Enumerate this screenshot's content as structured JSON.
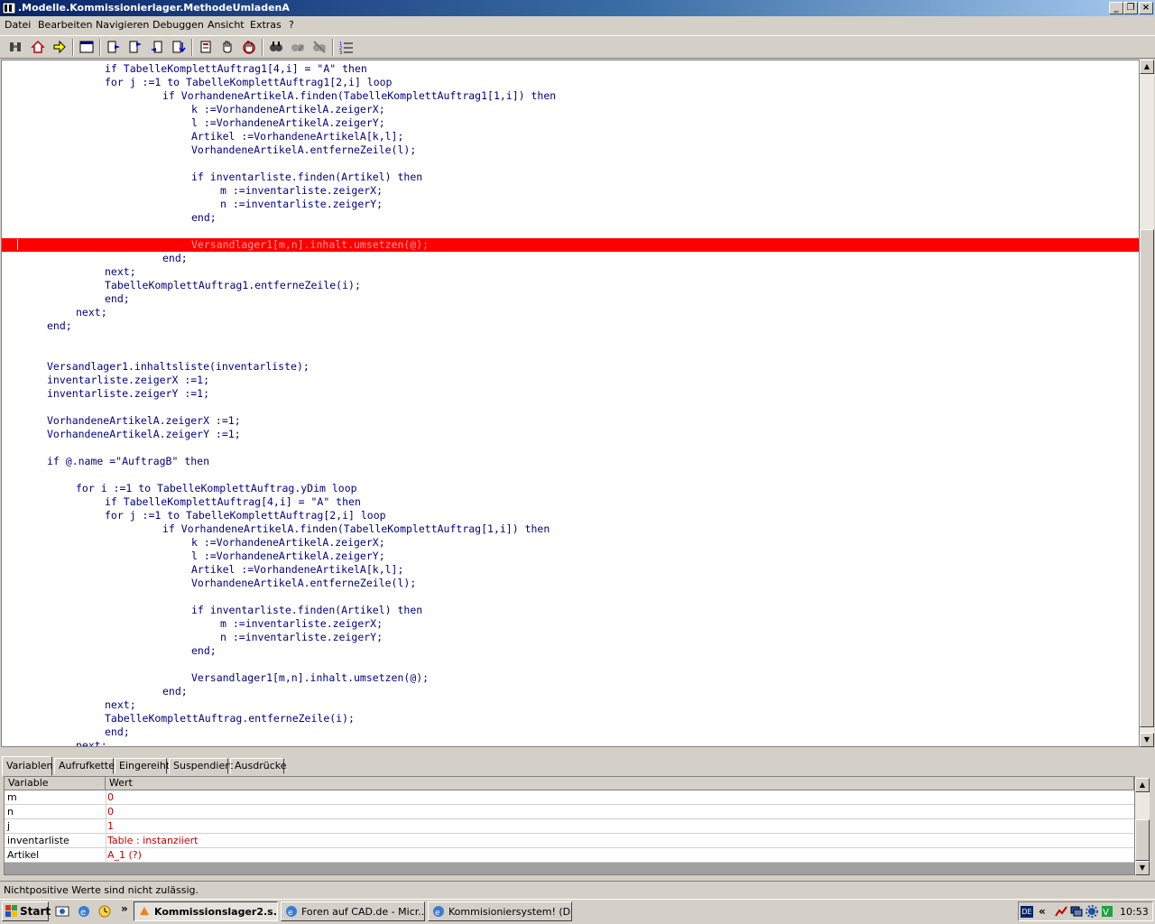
{
  "window": {
    "title": ".Modelle.Kommissionierlager.MethodeUmladenA"
  },
  "menu": [
    "Datei",
    "Bearbeiten",
    "Navigieren",
    "Debuggen",
    "Ansicht",
    "Extras",
    "?"
  ],
  "toolbar_icons": [
    "binoculars-icon",
    "home-icon",
    "arrow-right-icon",
    "window-icon",
    "step-into-icon",
    "step-over-icon",
    "step-out-icon",
    "run-to-icon",
    "breakpoint-icon",
    "hand-icon",
    "stop-hand-icon",
    "find-icon",
    "replace-icon",
    "replace-all-icon",
    "list-icon"
  ],
  "code_lines": [
    {
      "indent": 14,
      "text": "if TabelleKomplettAuftrag1[4,i] = \"A\" then"
    },
    {
      "indent": 14,
      "text": "for j :=1 to TabelleKomplettAuftrag1[2,i] loop"
    },
    {
      "indent": 22,
      "text": "if VorhandeneArtikelA.finden(TabelleKomplettAuftrag1[1,i]) then"
    },
    {
      "indent": 26,
      "text": "k :=VorhandeneArtikelA.zeigerX;"
    },
    {
      "indent": 26,
      "text": "l :=VorhandeneArtikelA.zeigerY;"
    },
    {
      "indent": 26,
      "text": "Artikel :=VorhandeneArtikelA[k,l];"
    },
    {
      "indent": 26,
      "text": "VorhandeneArtikelA.entferneZeile(l);"
    },
    {
      "indent": 0,
      "text": ""
    },
    {
      "indent": 26,
      "text": "if inventarliste.finden(Artikel) then"
    },
    {
      "indent": 30,
      "text": "m :=inventarliste.zeigerX;"
    },
    {
      "indent": 30,
      "text": "n :=inventarliste.zeigerY;"
    },
    {
      "indent": 26,
      "text": "end;"
    },
    {
      "indent": 0,
      "text": ""
    },
    {
      "indent": 26,
      "text": "Versandlager1[m,n].inhalt.umsetzen(@);",
      "breakpoint": true
    },
    {
      "indent": 22,
      "text": "end;"
    },
    {
      "indent": 14,
      "text": "next;"
    },
    {
      "indent": 14,
      "text": "TabelleKomplettAuftrag1.entferneZeile(i);"
    },
    {
      "indent": 14,
      "text": "end;"
    },
    {
      "indent": 10,
      "text": "next;"
    },
    {
      "indent": 6,
      "text": "end;"
    },
    {
      "indent": 0,
      "text": ""
    },
    {
      "indent": 0,
      "text": ""
    },
    {
      "indent": 6,
      "text": "Versandlager1.inhaltsliste(inventarliste);"
    },
    {
      "indent": 6,
      "text": "inventarliste.zeigerX :=1;"
    },
    {
      "indent": 6,
      "text": "inventarliste.zeigerY :=1;"
    },
    {
      "indent": 0,
      "text": ""
    },
    {
      "indent": 6,
      "text": "VorhandeneArtikelA.zeigerX :=1;"
    },
    {
      "indent": 6,
      "text": "VorhandeneArtikelA.zeigerY :=1;"
    },
    {
      "indent": 0,
      "text": ""
    },
    {
      "indent": 6,
      "text": "if @.name =\"AuftragB\" then"
    },
    {
      "indent": 0,
      "text": ""
    },
    {
      "indent": 10,
      "text": "for i :=1 to TabelleKomplettAuftrag.yDim loop"
    },
    {
      "indent": 14,
      "text": "if TabelleKomplettAuftrag[4,i] = \"A\" then"
    },
    {
      "indent": 14,
      "text": "for j :=1 to TabelleKomplettAuftrag[2,i] loop"
    },
    {
      "indent": 22,
      "text": "if VorhandeneArtikelA.finden(TabelleKomplettAuftrag[1,i]) then"
    },
    {
      "indent": 26,
      "text": "k :=VorhandeneArtikelA.zeigerX;"
    },
    {
      "indent": 26,
      "text": "l :=VorhandeneArtikelA.zeigerY;"
    },
    {
      "indent": 26,
      "text": "Artikel :=VorhandeneArtikelA[k,l];"
    },
    {
      "indent": 26,
      "text": "VorhandeneArtikelA.entferneZeile(l);"
    },
    {
      "indent": 0,
      "text": ""
    },
    {
      "indent": 26,
      "text": "if inventarliste.finden(Artikel) then"
    },
    {
      "indent": 30,
      "text": "m :=inventarliste.zeigerX;"
    },
    {
      "indent": 30,
      "text": "n :=inventarliste.zeigerY;"
    },
    {
      "indent": 26,
      "text": "end;"
    },
    {
      "indent": 0,
      "text": ""
    },
    {
      "indent": 26,
      "text": "Versandlager1[m,n].inhalt.umsetzen(@);"
    },
    {
      "indent": 22,
      "text": "end;"
    },
    {
      "indent": 14,
      "text": "next;"
    },
    {
      "indent": 14,
      "text": "TabelleKomplettAuftrag.entferneZeile(i);"
    },
    {
      "indent": 14,
      "text": "end;"
    },
    {
      "indent": 10,
      "text": "next;"
    }
  ],
  "debug_tabs": [
    "Variablen",
    "Aufrufkette",
    "Eingereiht",
    "Suspendiert",
    "Ausdrücke"
  ],
  "variables": {
    "col_variable": "Variable",
    "col_wert": "Wert",
    "rows": [
      {
        "name": "m",
        "value": "0"
      },
      {
        "name": "n",
        "value": "0"
      },
      {
        "name": "j",
        "value": "1"
      },
      {
        "name": "inventarliste",
        "value": "Table : instanziiert"
      },
      {
        "name": "Artikel",
        "value": "A_1 (?)"
      }
    ]
  },
  "status_message": "Nichtpositive Werte sind nicht zulässig.",
  "taskbar": {
    "start_label": "Start",
    "quick_launch_chevron": "»",
    "tasks": [
      {
        "label": "Kommissionslager2.s...",
        "active": true
      },
      {
        "label": "Foren auf CAD.de - Micr...",
        "active": false
      },
      {
        "label": "Kommisioniersystem! (Di...",
        "active": false
      }
    ],
    "tray": {
      "language": "DE",
      "chevron": "«",
      "clock": "10:53"
    }
  },
  "colors": {
    "breakpoint_line": "#ff0000",
    "keyword": "#00007f",
    "variable_value": "#c00000"
  }
}
